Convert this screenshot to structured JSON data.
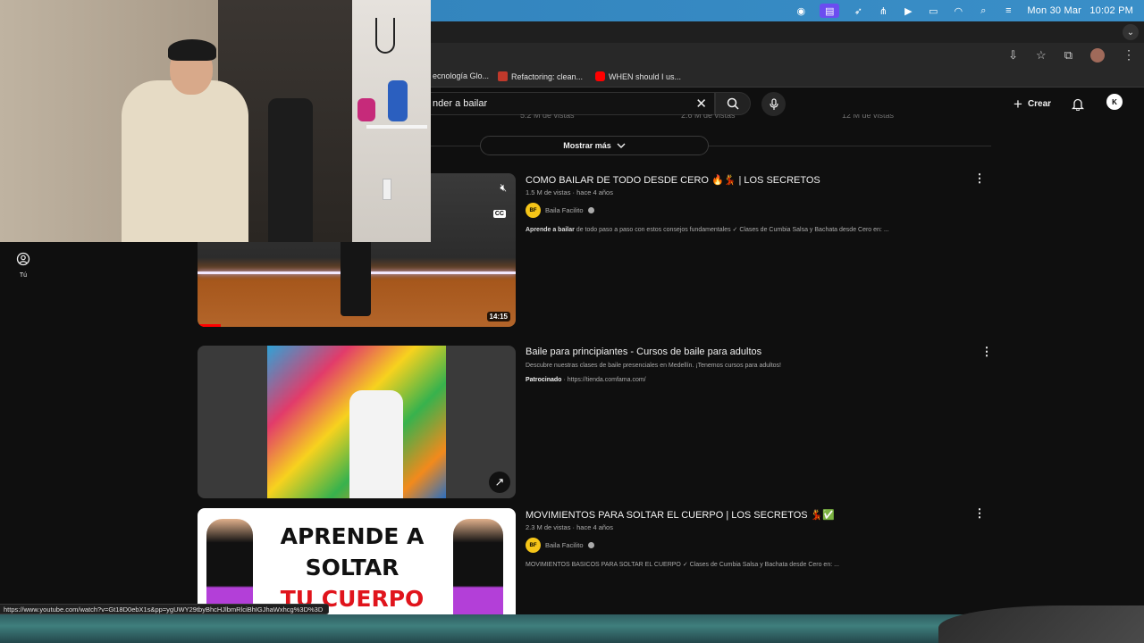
{
  "menubar": {
    "clock_date": "Mon 30 Mar",
    "clock_time": "10:02 PM"
  },
  "bookmarks": [
    {
      "label": "ecnología Glo..."
    },
    {
      "label": "Refactoring: clean..."
    },
    {
      "label": "WHEN should I us..."
    }
  ],
  "youtube": {
    "search_value": "nder a bailar",
    "create_label": "Crear",
    "avatar_letter": "K",
    "show_more": "Mostrar más",
    "prev_views": [
      "5.2 M de vistas",
      "2.6 M de vistas",
      "12 M de vistas"
    ],
    "sidebar_you_label": "Tú"
  },
  "results": [
    {
      "title": "COMO BAILAR DE TODO DESDE CERO 🔥💃 | LOS SECRETOS",
      "meta": "1.5 M de vistas · hace 4 años",
      "channel": "Baila Facilito",
      "desc_bold": "Aprende a bailar",
      "desc_rest": " de todo paso a paso con estos consejos fundamentales ✓ Clases de Cumbia Salsa y Bachata desde Cero en: ...",
      "duration": "14:15",
      "cc": "CC"
    },
    {
      "title": "Baile para principiantes - Cursos de baile para adultos",
      "desc": "Descubre nuestras clases de baile presenciales en Medellín. ¡Tenemos cursos para adultos!",
      "sponsored": "Patrocinado",
      "url": "https://tienda.comfama.com/"
    },
    {
      "title": "MOVIMIENTOS PARA SOLTAR EL CUERPO | LOS SECRETOS 💃✅",
      "meta": "2.3 M de vistas · hace 4 años",
      "channel": "Baila Facilito",
      "desc": "MOVIMIENTOS BASICOS PARA SOLTAR EL CUERPO ✓ Clases de Cumbia Salsa y Bachata desde Cero en: ...",
      "thumb_text": [
        "APRENDE A",
        "SOLTAR",
        "TU CUERPO"
      ]
    }
  ],
  "status_url": "https://www.youtube.com/watch?v=Gt18D0ebX1s&pp=ygUWY29tbyBhcHJlbmRlciBhIGJhaWxhcg%3D%3D"
}
